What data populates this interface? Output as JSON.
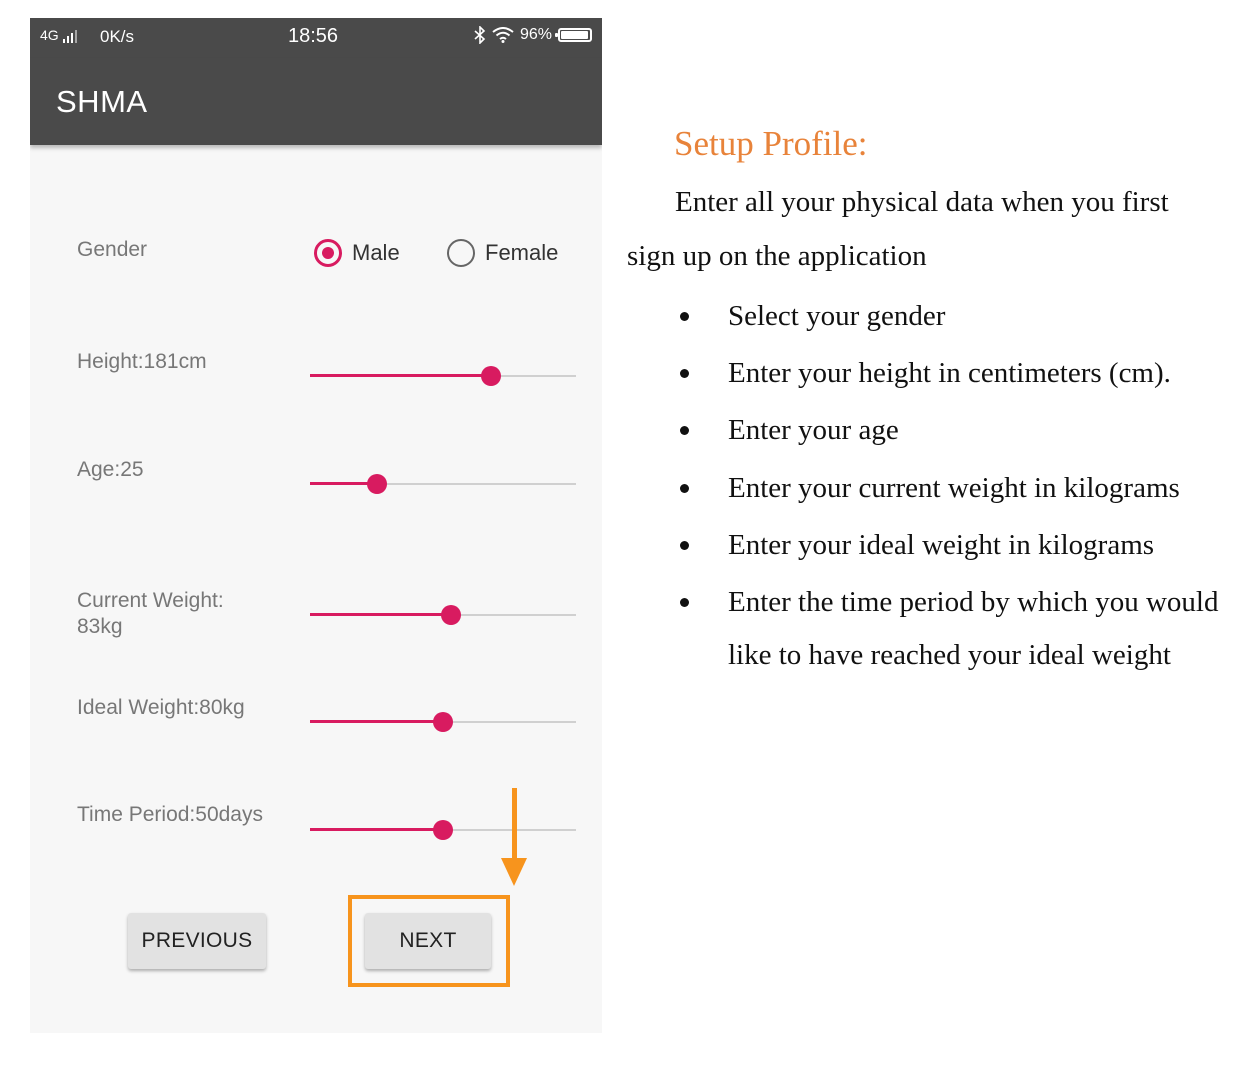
{
  "status_bar": {
    "network": "4G",
    "speed": "0K/s",
    "time": "18:56",
    "battery": "96%",
    "battery_level": 0.96
  },
  "app": {
    "title": "SHMA"
  },
  "form": {
    "gender": {
      "label": "Gender",
      "options": [
        "Male",
        "Female"
      ],
      "selected": "Male"
    },
    "height": {
      "label": "Height:181cm",
      "level": 0.68
    },
    "age": {
      "label": "Age:25",
      "level": 0.25
    },
    "current_weight": {
      "label": "Current Weight:\n83kg",
      "level": 0.53
    },
    "ideal_weight": {
      "label": "Ideal Weight:80kg",
      "level": 0.5
    },
    "time_period": {
      "label": "Time Period:50days",
      "level": 0.5
    },
    "previous_label": "PREVIOUS",
    "next_label": "NEXT"
  },
  "colors": {
    "accent": "#d81b60",
    "appbar": "#4a4a4a",
    "highlight": "#f7941d",
    "heading": "#e8833a"
  },
  "doc": {
    "heading": "Setup Profile:",
    "intro_line1": "Enter all your physical data when you first",
    "intro_line2": "sign up on the application",
    "bullets": [
      "Select your gender",
      "Enter your height in centimeters (cm).",
      "Enter your age",
      "Enter your current weight in kilograms",
      "Enter your ideal weight in kilograms",
      "Enter the time period by which you would like to have reached your ideal weight"
    ]
  }
}
